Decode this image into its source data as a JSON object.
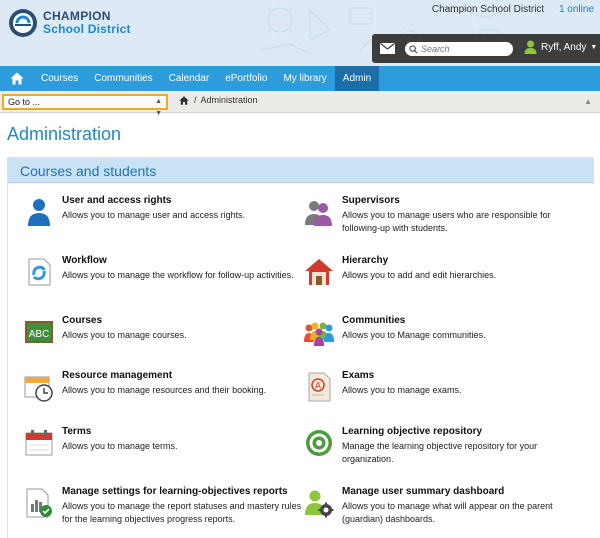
{
  "header": {
    "logo_line1": "CHAMPION",
    "logo_line2": "School District",
    "district": "Champion School District",
    "online": "1 online",
    "search_placeholder": "Search",
    "user_name": "Ryff, Andy",
    "mail_icon": "mail-icon",
    "user_icon": "user-icon"
  },
  "nav": {
    "home_icon": "home-icon",
    "items": [
      "Courses",
      "Communities",
      "Calendar",
      "ePortfolio",
      "My library",
      "Admin"
    ],
    "active": "Admin"
  },
  "crumbbar": {
    "goto": "Go to ...",
    "crumb": "Administration"
  },
  "page": {
    "title": "Administration",
    "section_title": "Courses and students"
  },
  "items": [
    {
      "title": "User and access rights",
      "desc": "Allows you to manage user and access rights.",
      "icon": "user-icon"
    },
    {
      "title": "Supervisors",
      "desc": "Allows you to manage users who are responsible for following-up with students.",
      "icon": "supervisors-icon"
    },
    {
      "title": "Workflow",
      "desc": "Allows you to manage the workflow for follow-up activities.",
      "icon": "workflow-icon"
    },
    {
      "title": "Hierarchy",
      "desc": "Allows you to add and edit hierarchies.",
      "icon": "house-icon"
    },
    {
      "title": "Courses",
      "desc": "Allows you to manage courses.",
      "icon": "abc-board-icon"
    },
    {
      "title": "Communities",
      "desc": "Allows you to Manage communities.",
      "icon": "community-icon"
    },
    {
      "title": "Resource management",
      "desc": "Allows you to manage resources and their booking.",
      "icon": "calendar-clock-icon"
    },
    {
      "title": "Exams",
      "desc": "Allows you to manage exams.",
      "icon": "exam-icon"
    },
    {
      "title": "Terms",
      "desc": "Allows you to manage terms.",
      "icon": "calendar-icon"
    },
    {
      "title": "Learning objective repository",
      "desc": "Manage the learning objective repository for your organization.",
      "icon": "target-icon"
    },
    {
      "title": "Manage settings for learning-objectives reports",
      "desc": "Allows you to manage the report statuses and mastery rules for the learning objectives progress reports.",
      "icon": "report-chart-icon"
    },
    {
      "title": "Manage user summary dashboard",
      "desc": "Allows you to manage what will appear on the parent (guardian) dashboards.",
      "icon": "user-settings-icon"
    }
  ]
}
